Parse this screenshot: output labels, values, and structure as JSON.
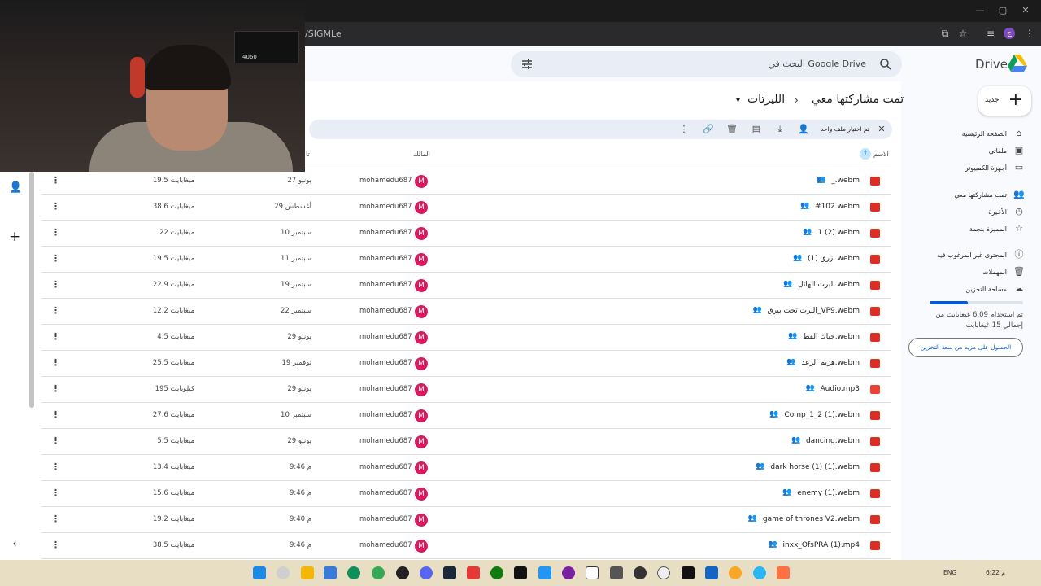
{
  "browser": {
    "url_fragment": "/SIGMLe",
    "profile_initial": "ج"
  },
  "drive": {
    "logo_text": "Drive",
    "search_placeholder": "البحث في Google Drive"
  },
  "sidebar": {
    "new_label": "جديد",
    "items": [
      {
        "label": "الصفحة الرئيسية",
        "icon": "home-icon"
      },
      {
        "label": "ملفاتي",
        "icon": "my-drive-icon"
      },
      {
        "label": "أجهزة الكمبيوتر",
        "icon": "computers-icon"
      },
      {
        "label": "تمت مشاركتها معي",
        "icon": "shared-icon"
      },
      {
        "label": "الأخيرة",
        "icon": "clock-icon"
      },
      {
        "label": "المميزة بنجمة",
        "icon": "star-icon"
      },
      {
        "label": "المحتوى غير المرغوب فيه",
        "icon": "spam-icon"
      },
      {
        "label": "المهملات",
        "icon": "trash-icon"
      },
      {
        "label": "مساحة التخزين",
        "icon": "cloud-icon"
      }
    ],
    "storage_text": "تم استخدام 6.09 غيغابايت من إجمالي 15 غيغابايت",
    "storage_fraction": 0.41,
    "get_storage_label": "الحصول على مزيد من سعة التخزين"
  },
  "breadcrumb": {
    "root": "تمت مشاركتها معي",
    "separator": "›",
    "current": "الليرتات",
    "dropdown": "▾"
  },
  "selection_bar": {
    "text": "تم اختيار ملف واحد"
  },
  "columns": {
    "name": "الاسم",
    "owner": "المالك",
    "modified": "تا"
  },
  "files": [
    {
      "name": "_.webm",
      "owner": "mohamedu687",
      "date": "27 يونيو",
      "size": "19.5 ميغابايت",
      "type": "video"
    },
    {
      "name": "#102.webm",
      "owner": "mohamedu687",
      "date": "29 أغسطس",
      "size": "38.6 ميغابايت",
      "type": "video"
    },
    {
      "name": "1 (2).webm",
      "owner": "mohamedu687",
      "date": "10 سبتمبر",
      "size": "22 ميغابايت",
      "type": "video"
    },
    {
      "name": "ازرق (1).webm",
      "owner": "mohamedu687",
      "date": "11 سبتمبر",
      "size": "19.5 ميغابايت",
      "type": "video"
    },
    {
      "name": "البرت الهاتل.webm",
      "owner": "mohamedu687",
      "date": "19 سبتمبر",
      "size": "22.9 ميغابايت",
      "type": "video"
    },
    {
      "name": "البرت تحت بيرق_VP9.webm",
      "owner": "mohamedu687",
      "date": "22 سبتمبر",
      "size": "12.2 ميغابايت",
      "type": "video"
    },
    {
      "name": "جياك الفط.webm",
      "owner": "mohamedu687",
      "date": "29 يونيو",
      "size": "4.5 ميغابايت",
      "type": "video"
    },
    {
      "name": "هزيم الرعد.webm",
      "owner": "mohamedu687",
      "date": "19 نوفمبر",
      "size": "25.5 ميغابايت",
      "type": "video"
    },
    {
      "name": "Audio.mp3",
      "owner": "mohamedu687",
      "date": "29 يونيو",
      "size": "195 كيلوبايت",
      "type": "audio"
    },
    {
      "name": "Comp_1_2 (1).webm",
      "owner": "mohamedu687",
      "date": "10 سبتمبر",
      "size": "27.6 ميغابايت",
      "type": "video"
    },
    {
      "name": "dancing.webm",
      "owner": "mohamedu687",
      "date": "29 يونيو",
      "size": "5.5 ميغابايت",
      "type": "video"
    },
    {
      "name": "dark horse (1) (1).webm",
      "owner": "mohamedu687",
      "date": "9:46 م",
      "size": "13.4 ميغابايت",
      "type": "video"
    },
    {
      "name": "enemy (1).webm",
      "owner": "mohamedu687",
      "date": "9:46 م",
      "size": "15.6 ميغابايت",
      "type": "video"
    },
    {
      "name": "game of thrones V2.webm",
      "owner": "mohamedu687",
      "date": "9:40 م",
      "size": "19.2 ميغابايت",
      "type": "video"
    },
    {
      "name": "inxx_OfsPRA (1).mp4",
      "owner": "mohamedu687",
      "date": "9:46 م",
      "size": "38.5 ميغابايت",
      "type": "video"
    }
  ],
  "avatar_initial": "M",
  "webcam": {
    "box_text": "4060"
  },
  "taskbar": {
    "lang": "ENG",
    "clock": "6:22 م"
  }
}
